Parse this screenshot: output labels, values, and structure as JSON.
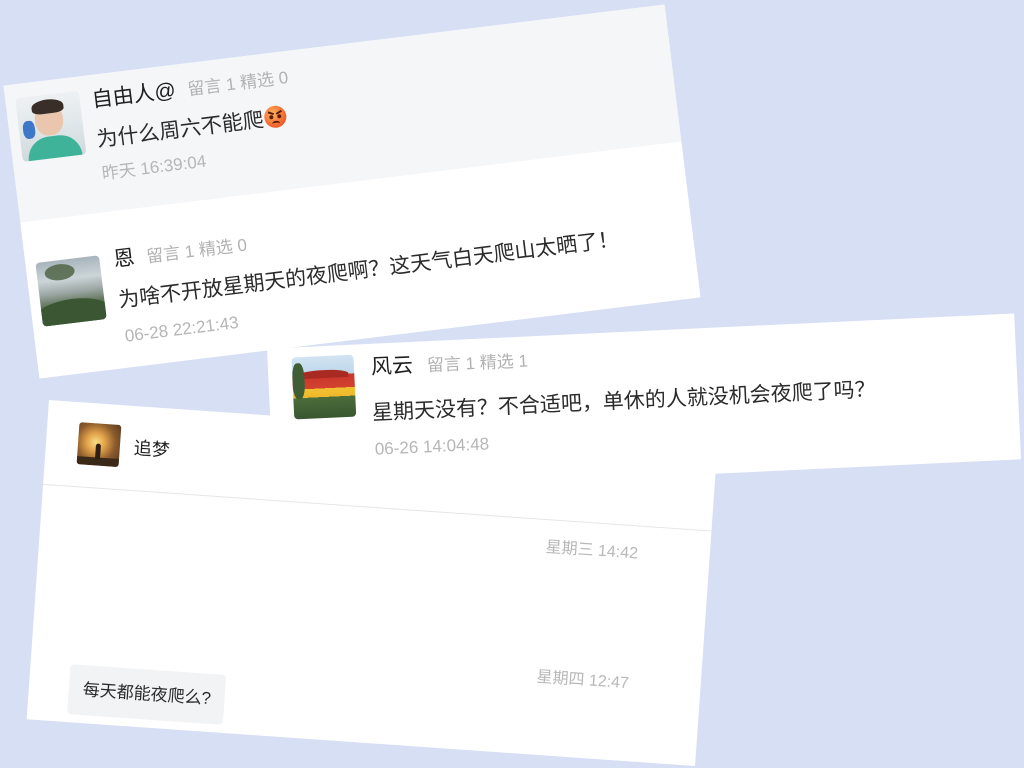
{
  "page": {
    "background_color": "#d6dff4"
  },
  "comment_panel": {
    "highlight_color": "#f5f6f8",
    "comments": [
      {
        "avatar_icon": "avatar-boy-green-shirt-icon",
        "author": "自由人@",
        "stats": "留言 1 精选 0",
        "text": "为什么周六不能爬",
        "emoji_icon": "angry-face-icon",
        "time": "昨天 16:39:04"
      },
      {
        "avatar_icon": "avatar-landscape-icon",
        "author": "恩",
        "stats": "留言 1 精选 0",
        "text": "为啥不开放星期天的夜爬啊？这天气白天爬山太晒了！",
        "time": "06-28 22:21:43"
      }
    ]
  },
  "comment_panel_2": {
    "comments": [
      {
        "avatar_icon": "avatar-red-building-icon",
        "author": "风云",
        "stats": "留言 1 精选 1",
        "text": "星期天没有？不合适吧，单休的人就没机会夜爬了吗？",
        "time": "06-26 14:04:48"
      }
    ]
  },
  "chat_window": {
    "contact": {
      "avatar_icon": "avatar-sunset-silhouette-icon",
      "name": "追梦"
    },
    "timestamps": [
      "星期三 14:42",
      "星期四 12:47"
    ],
    "messages": [
      {
        "text": "每天都能夜爬么?"
      }
    ]
  }
}
